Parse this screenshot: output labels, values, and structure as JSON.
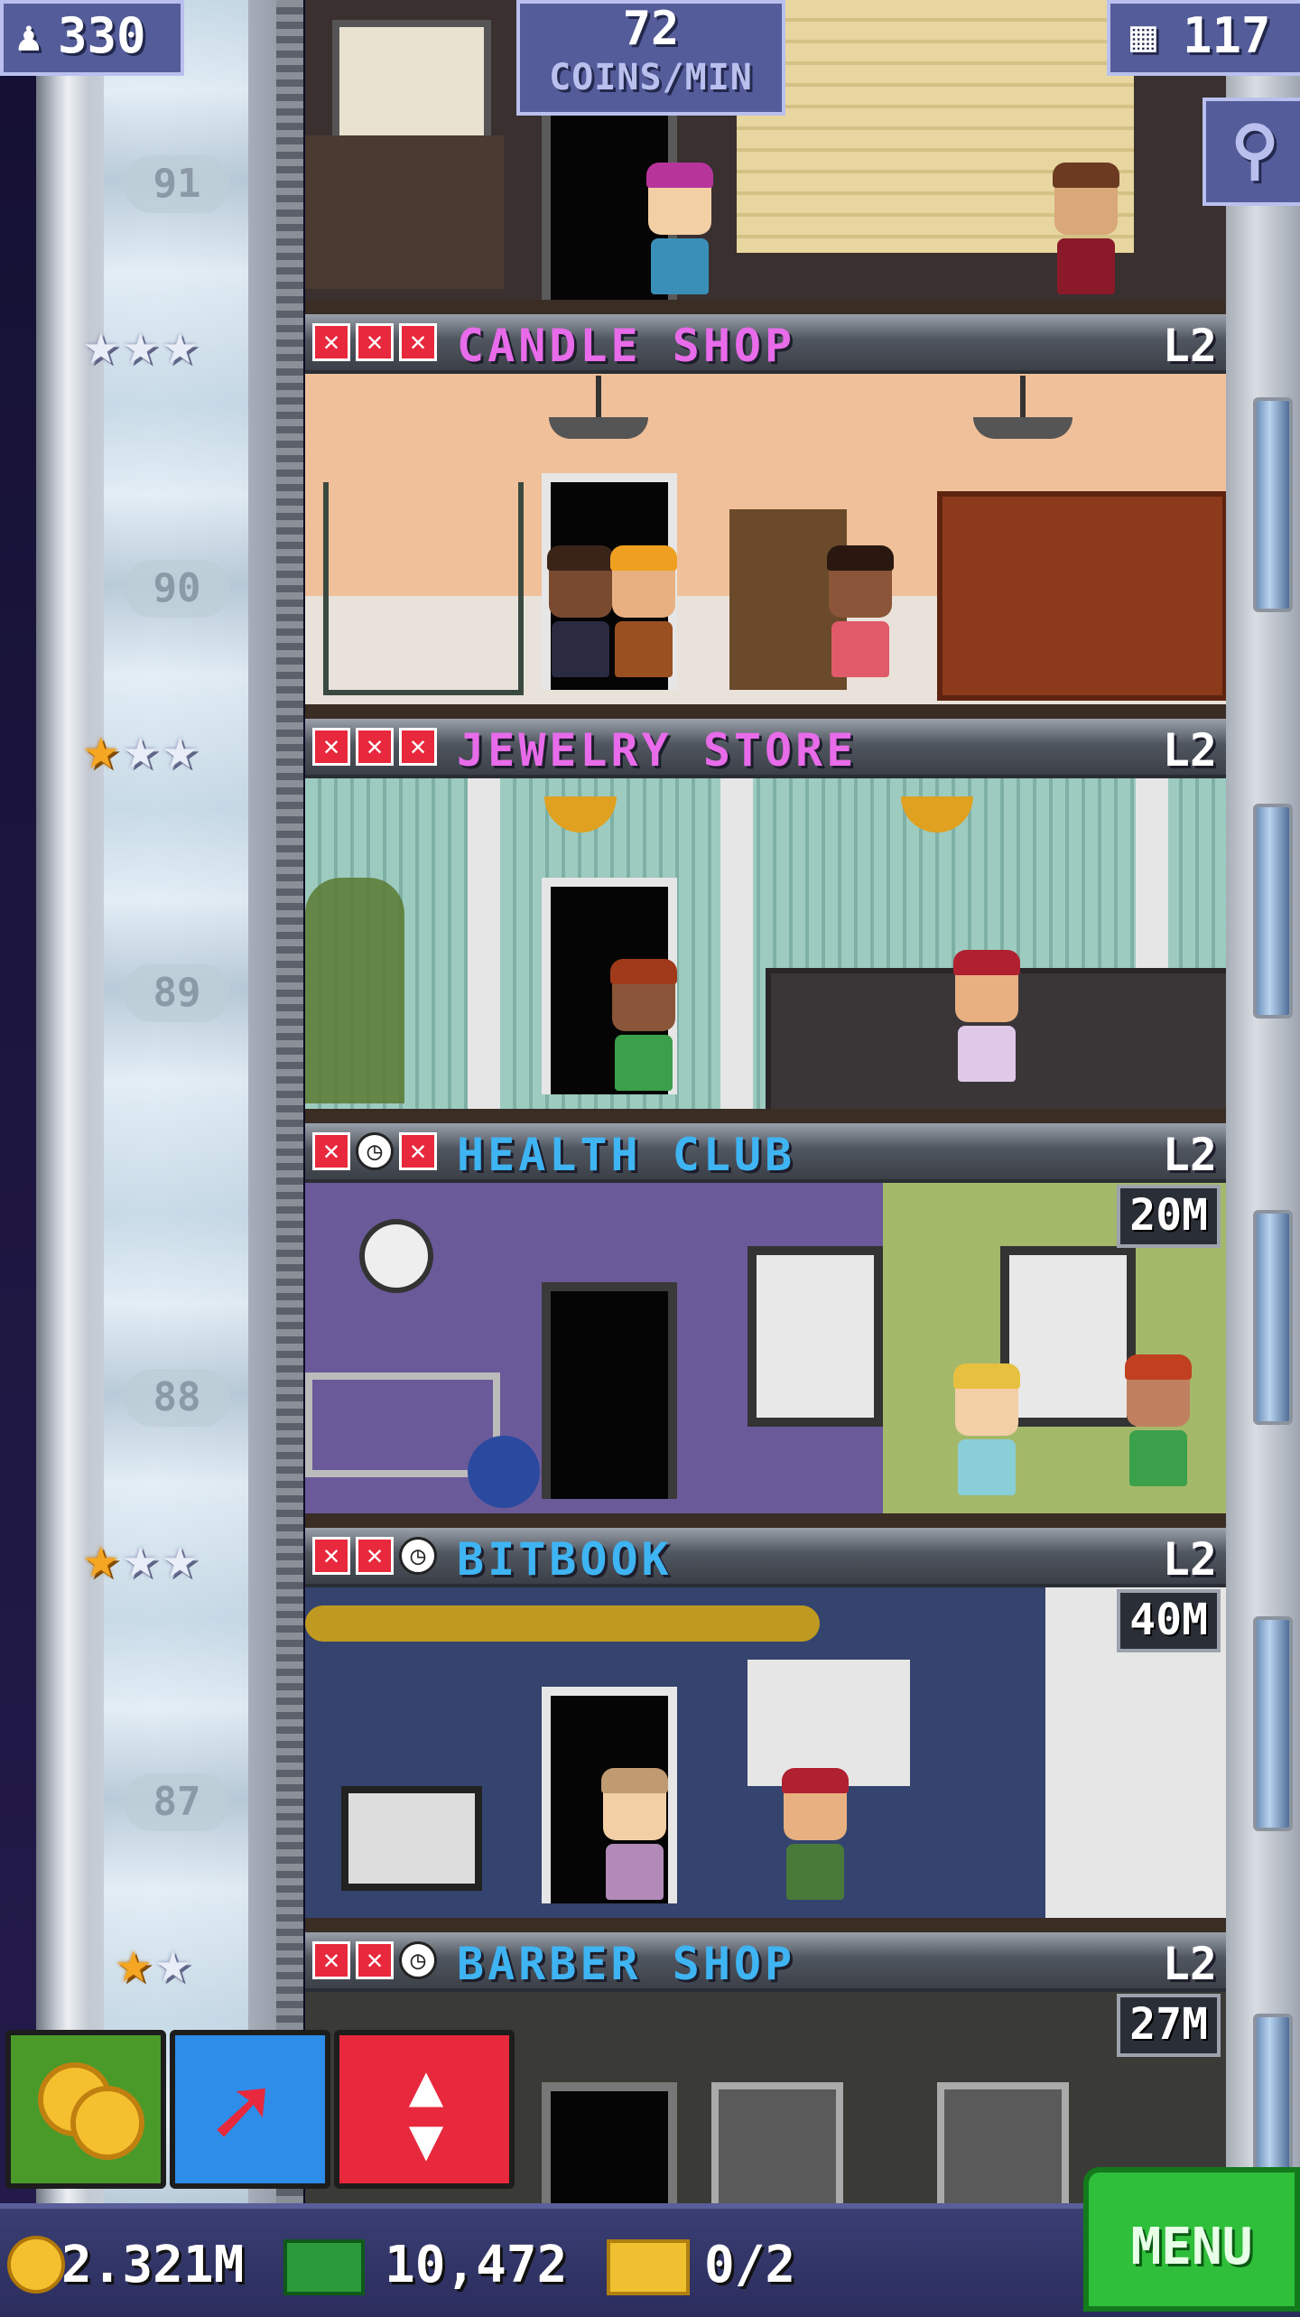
{
  "hud": {
    "population": "330",
    "coins_rate_value": "72",
    "coins_rate_unit": "COINS/MIN",
    "floor_count": "117"
  },
  "floors": [
    {
      "number": "91"
    },
    {
      "number": "90",
      "name": "CANDLE SHOP",
      "level": "L2",
      "color": "#e86bea"
    },
    {
      "number": "89",
      "name": "JEWELRY STORE",
      "level": "L2",
      "color": "#e86bea"
    },
    {
      "number": "88",
      "name": "HEALTH CLUB",
      "level": "L2",
      "timer": "20M",
      "color": "#3fb4f3"
    },
    {
      "number": "87",
      "name": "BITBOOK",
      "level": "L2",
      "timer": "40M",
      "color": "#3fb4f3"
    },
    {
      "name": "BARBER SHOP",
      "level": "L2",
      "timer": "27M",
      "color": "#3fb4f3"
    }
  ],
  "footer": {
    "coins": "2.321M",
    "bux": "10,472",
    "tickets": "0/2",
    "menu_label": "MENU"
  },
  "icons": [
    "population-icon",
    "floors-icon",
    "zoom-icon",
    "coins-button-icon",
    "rocket-button-icon",
    "elevator-button-icon",
    "coin-icon",
    "bux-icon",
    "ticket-icon"
  ]
}
